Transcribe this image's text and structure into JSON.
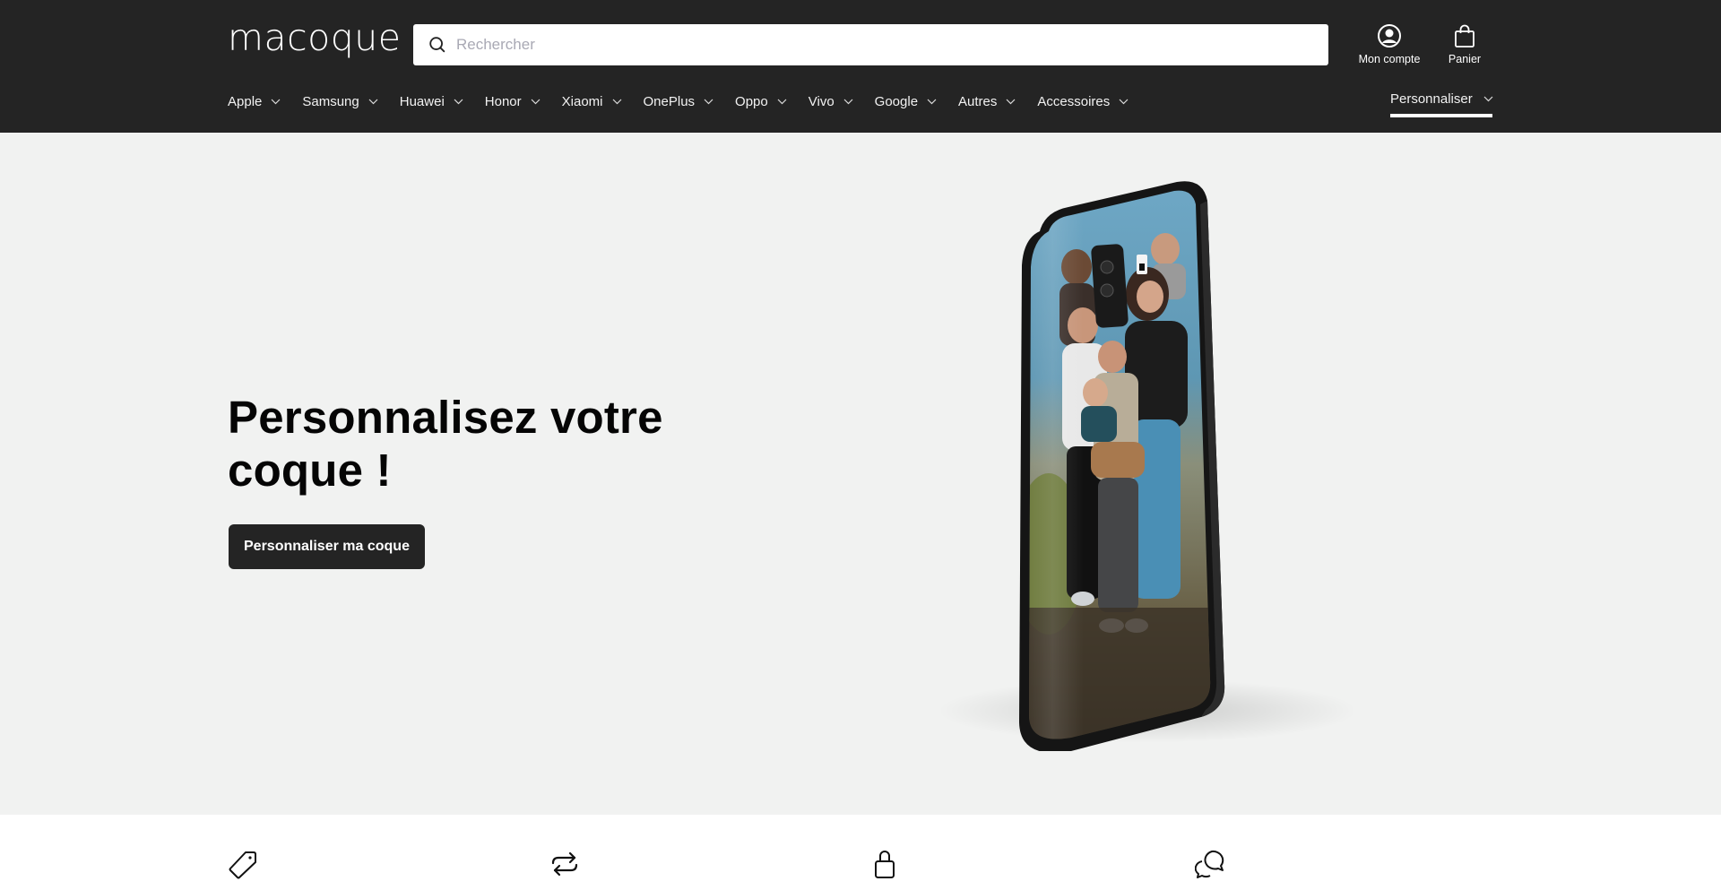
{
  "header": {
    "logo": "macoque",
    "search": {
      "placeholder": "Rechercher",
      "value": ""
    },
    "account_label": "Mon compte",
    "cart_label": "Panier"
  },
  "nav": {
    "items": [
      {
        "label": "Apple"
      },
      {
        "label": "Samsung"
      },
      {
        "label": "Huawei"
      },
      {
        "label": "Honor"
      },
      {
        "label": "Xiaomi"
      },
      {
        "label": "OnePlus"
      },
      {
        "label": "Oppo"
      },
      {
        "label": "Vivo"
      },
      {
        "label": "Google"
      },
      {
        "label": "Autres"
      },
      {
        "label": "Accessoires"
      }
    ],
    "right_item": {
      "label": "Personnaliser",
      "active": true
    }
  },
  "hero": {
    "title": "Personnalisez votre coque !",
    "cta_label": "Personnaliser ma coque",
    "image_alt": "Coque de téléphone personnalisée avec photo de famille"
  },
  "features": {
    "icons": [
      "tag-icon",
      "exchange-icon",
      "lock-icon",
      "chat-icon"
    ]
  },
  "colors": {
    "header_bg": "#242424",
    "hero_bg": "#f1f2f1",
    "cta_bg": "#242424",
    "text": "#050505"
  }
}
